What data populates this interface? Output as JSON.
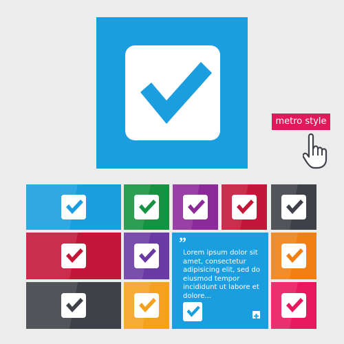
{
  "badge": {
    "label": "metro style"
  },
  "text_tile": {
    "quote_mark": "”",
    "lorem": "Lorem ipsum dolor sit amet, consectetur adipisicing elit, sed do eiusmod tempor incididunt ut labore et dolore...",
    "plus_symbol": "+"
  },
  "icons": {
    "main": "check-mark-icon",
    "cursor": "hand-pointer-icon"
  },
  "colors": {
    "blue": "#1b9ee0",
    "green": "#169342",
    "purple": "#8c2a9a",
    "crimson": "#c31638",
    "dark_gray": "#3f4148",
    "violet": "#6a3aa4",
    "orange": "#f08014",
    "amber": "#f5a120",
    "pink": "#e8185e",
    "badge_bg": "#e3185b",
    "background": "#ececec"
  }
}
